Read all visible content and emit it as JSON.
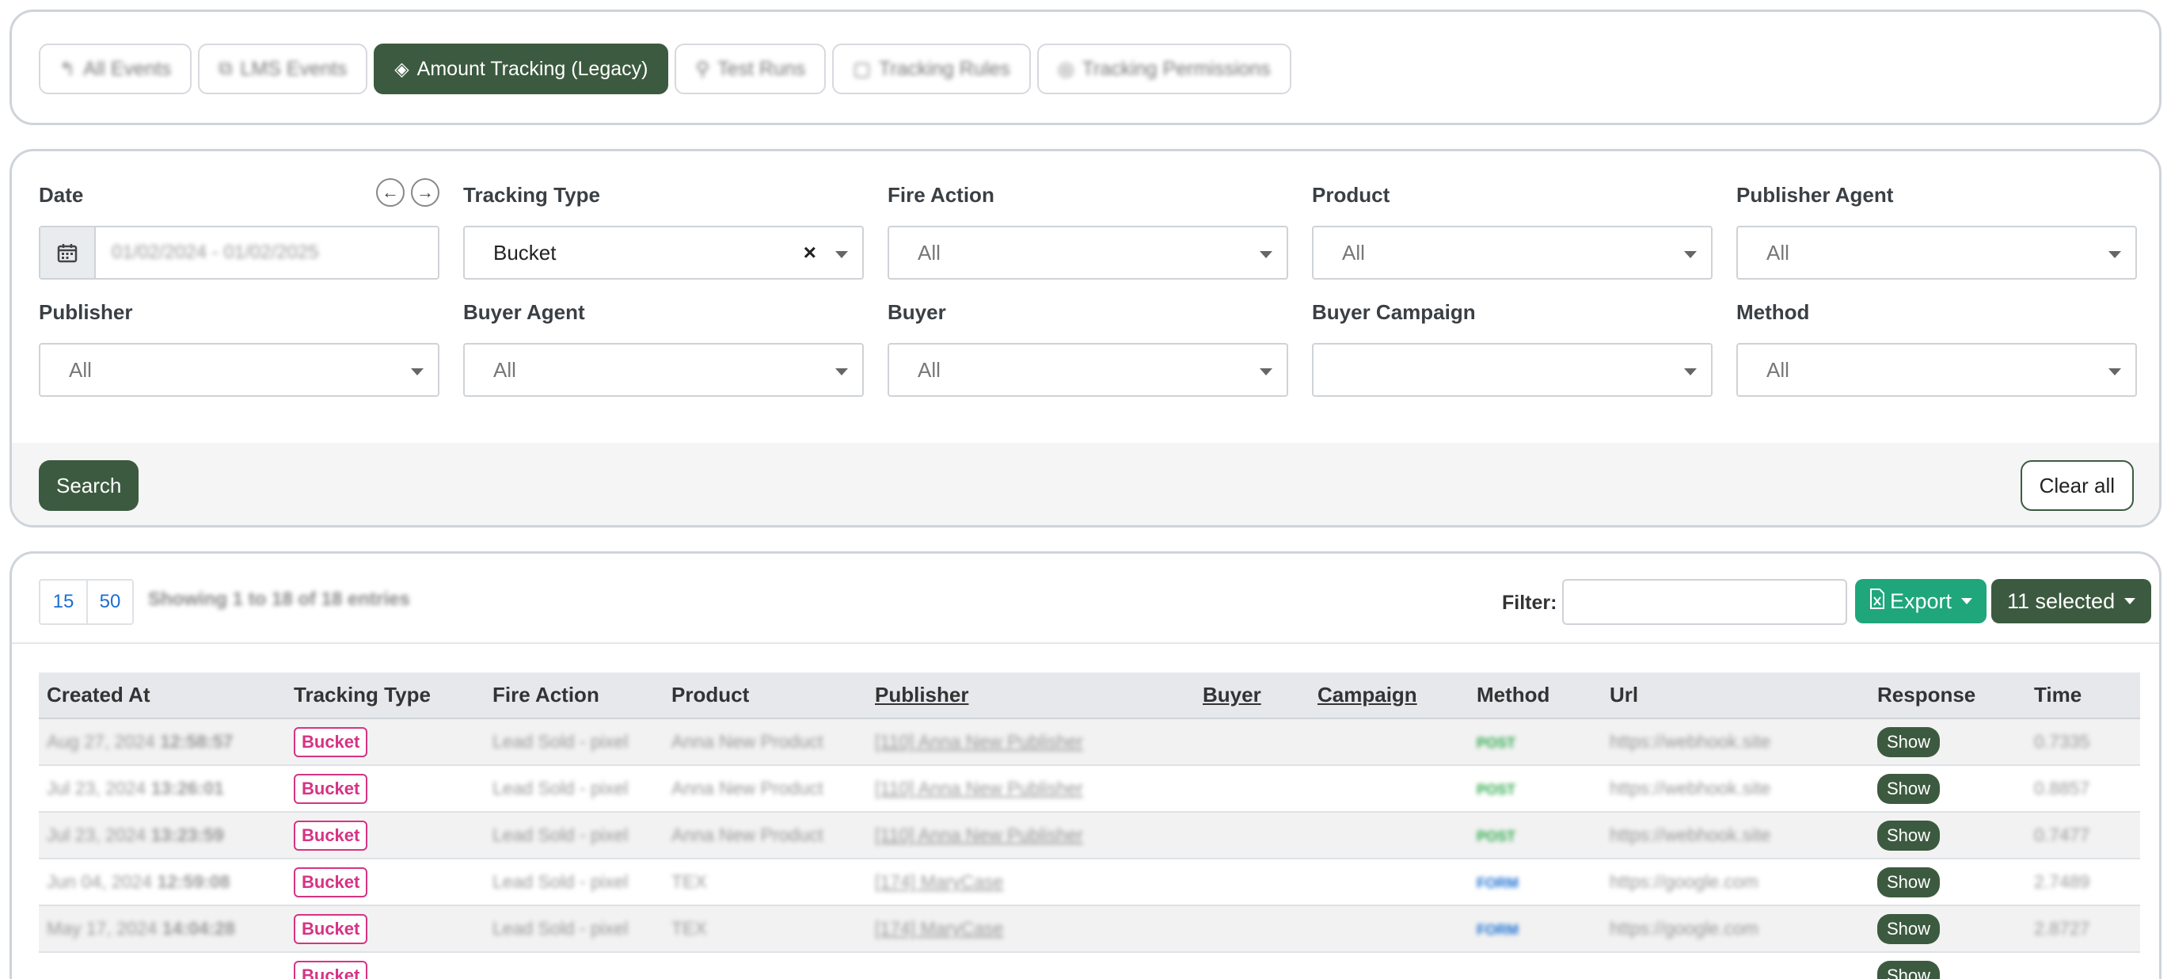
{
  "tabs": [
    {
      "label": "All Events",
      "icon": "reply-icon",
      "glyph": "↰",
      "active": false
    },
    {
      "label": "LMS Events",
      "icon": "copy-icon",
      "glyph": "⧉",
      "active": false
    },
    {
      "label": "Amount Tracking (Legacy)",
      "icon": "fill-drip-icon",
      "glyph": "◈",
      "active": true
    },
    {
      "label": "Test Runs",
      "icon": "pin-icon",
      "glyph": "⚲",
      "active": false
    },
    {
      "label": "Tracking Rules",
      "icon": "clipboard-icon",
      "glyph": "▢",
      "active": false
    },
    {
      "label": "Tracking Permissions",
      "icon": "check-circle-icon",
      "glyph": "◎",
      "active": false
    }
  ],
  "filters": {
    "date": {
      "label": "Date",
      "value": "01/02/2024 - 01/02/2025"
    },
    "tracking_type": {
      "label": "Tracking Type",
      "value": "Bucket",
      "clear": "×"
    },
    "fire_action": {
      "label": "Fire Action",
      "value": "All"
    },
    "product": {
      "label": "Product",
      "value": "All"
    },
    "publisher_agent": {
      "label": "Publisher Agent",
      "value": "All"
    },
    "publisher": {
      "label": "Publisher",
      "value": "All"
    },
    "buyer_agent": {
      "label": "Buyer Agent",
      "value": "All"
    },
    "buyer": {
      "label": "Buyer",
      "value": "All"
    },
    "buyer_campaign": {
      "label": "Buyer Campaign",
      "value": ""
    },
    "method": {
      "label": "Method",
      "value": "All"
    },
    "search_label": "Search",
    "clear_label": "Clear all"
  },
  "table_panel": {
    "page_sizes": [
      "15",
      "50"
    ],
    "showing": "Showing 1 to 18 of 18 entries",
    "filter_label": "Filter:",
    "export_label": "Export",
    "selected_label": "11 selected"
  },
  "table": {
    "columns": [
      "Created At",
      "Tracking Type",
      "Fire Action",
      "Product",
      "Publisher",
      "Buyer",
      "Campaign",
      "Method",
      "Url",
      "Response",
      "Time"
    ],
    "rows": [
      {
        "date": "Aug 27, 2024",
        "time": "12:58:57",
        "type": "Bucket",
        "fire": "Lead Sold - pixel",
        "product": "Anna New Product",
        "publisher": "[110] Anna New Publisher",
        "buyer": "",
        "campaign": "",
        "method": "POST",
        "url": "https://webhook.site",
        "response": "Show",
        "duration": "0.7335"
      },
      {
        "date": "Jul 23, 2024",
        "time": "13:26:01",
        "type": "Bucket",
        "fire": "Lead Sold - pixel",
        "product": "Anna New Product",
        "publisher": "[110] Anna New Publisher",
        "buyer": "",
        "campaign": "",
        "method": "POST",
        "url": "https://webhook.site",
        "response": "Show",
        "duration": "0.8857"
      },
      {
        "date": "Jul 23, 2024",
        "time": "13:23:59",
        "type": "Bucket",
        "fire": "Lead Sold - pixel",
        "product": "Anna New Product",
        "publisher": "[110] Anna New Publisher",
        "buyer": "",
        "campaign": "",
        "method": "POST",
        "url": "https://webhook.site",
        "response": "Show",
        "duration": "0.7477"
      },
      {
        "date": "Jun 04, 2024",
        "time": "12:59:08",
        "type": "Bucket",
        "fire": "Lead Sold - pixel",
        "product": "TEX",
        "publisher": "[174] MaryCase",
        "buyer": "",
        "campaign": "",
        "method": "FORM",
        "url": "https://google.com",
        "response": "Show",
        "duration": "2.7489"
      },
      {
        "date": "May 17, 2024",
        "time": "14:04:28",
        "type": "Bucket",
        "fire": "Lead Sold - pixel",
        "product": "TEX",
        "publisher": "[174] MaryCase",
        "buyer": "",
        "campaign": "",
        "method": "FORM",
        "url": "https://google.com",
        "response": "Show",
        "duration": "2.8727"
      },
      {
        "date": "",
        "time": "",
        "type": "Bucket",
        "fire": "",
        "product": "",
        "publisher": "",
        "buyer": "",
        "campaign": "",
        "method": "",
        "url": "",
        "response": "Show",
        "duration": ""
      }
    ]
  }
}
